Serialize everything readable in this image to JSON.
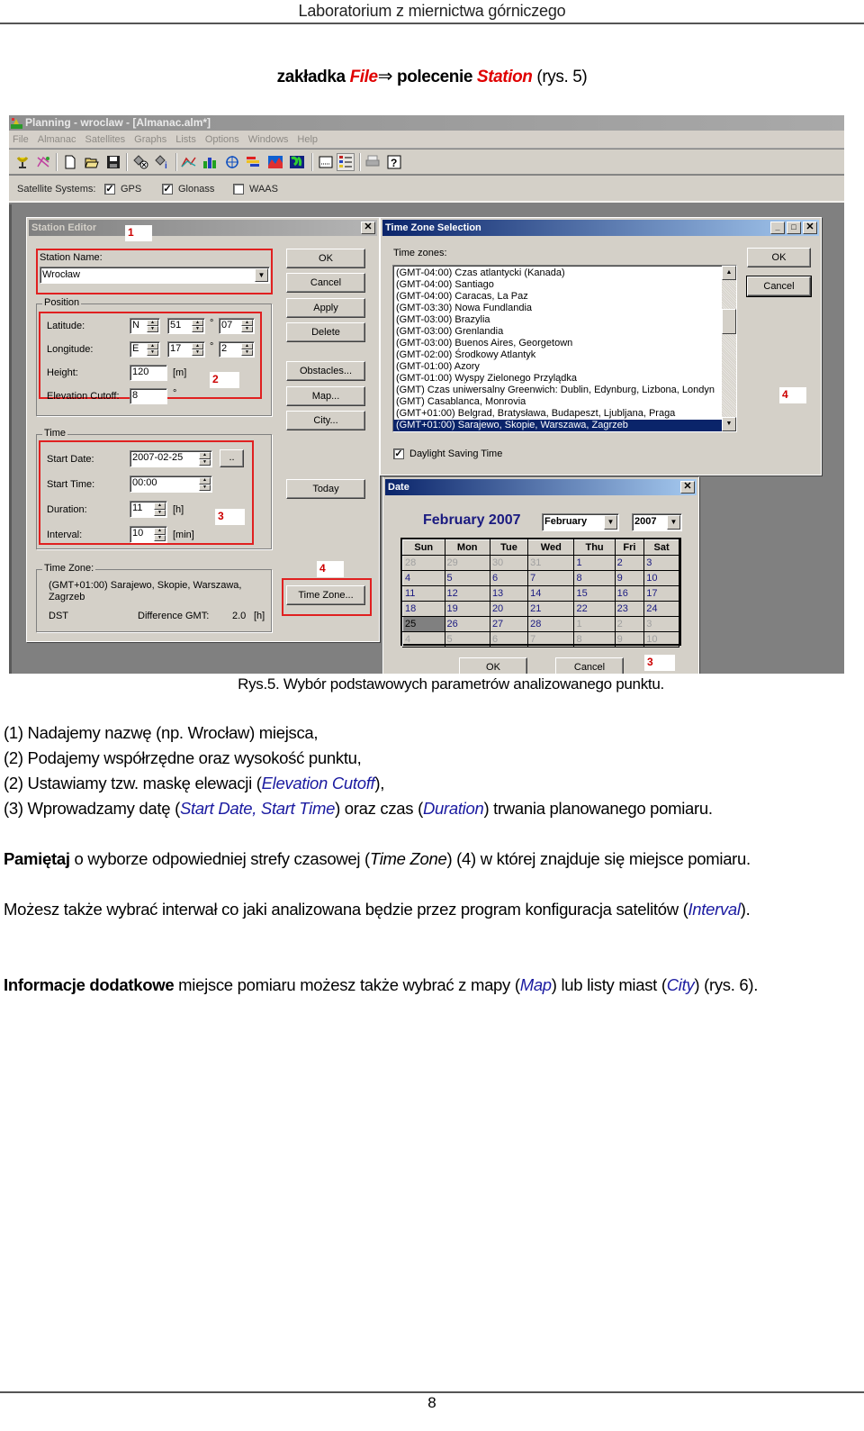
{
  "page_header": "Laboratorium z miernictwa górniczego",
  "heading": {
    "part1": "zakładka",
    "file": "File",
    "arrow": "⇒",
    "part2": "polecenie",
    "station": "Station",
    "part3": "(rys. 5)"
  },
  "app": {
    "title": "Planning - wroclaw - [Almanac.alm*]",
    "menu": [
      "File",
      "Almanac",
      "Satellites",
      "Graphs",
      "Lists",
      "Options",
      "Windows",
      "Help"
    ],
    "toolbar_icons": [
      "station-icon",
      "satellite-path-icon",
      "new-file-icon",
      "open-folder-icon",
      "save-icon",
      "satellite-delete-icon",
      "satellite-info-icon",
      "elevation-graph-icon",
      "number-of-satellites-icon",
      "sky-plot-icon",
      "visibility-icon",
      "dop-graph-icon",
      "world-view-icon",
      "window-icon",
      "list-icon",
      "print-icon",
      "help-icon"
    ],
    "satellite_systems": {
      "label": "Satellite Systems:",
      "items": [
        {
          "label": "GPS",
          "checked": true
        },
        {
          "label": "Glonass",
          "checked": true
        },
        {
          "label": "WAAS",
          "checked": false
        }
      ]
    }
  },
  "station_editor": {
    "title": "Station Editor",
    "station_name_label": "Station Name:",
    "station_name_value": "Wrocław",
    "position_group": "Position",
    "latitude_label": "Latitude:",
    "latitude_hemisphere": "N",
    "latitude_degrees": "51",
    "latitude_minutes": "07",
    "longitude_label": "Longitude:",
    "longitude_hemisphere": "E",
    "longitude_degrees": "17",
    "longitude_minutes": "2",
    "degree_symbol": "°",
    "height_label": "Height:",
    "height_value": "120",
    "height_unit": "[m]",
    "elevation_label": "Elevation Cutoff:",
    "elevation_value": "8",
    "elevation_unit": "°",
    "time_group": "Time",
    "start_date_label": "Start Date:",
    "start_date_value": "2007-02-25",
    "date_picker_button": "..",
    "start_time_label": "Start Time:",
    "start_time_value": "00:00",
    "duration_label": "Duration:",
    "duration_value": "11",
    "duration_unit": "[h]",
    "interval_label": "Interval:",
    "interval_value": "10",
    "interval_unit": "[min]",
    "timezone_group": "Time Zone:",
    "timezone_value": "(GMT+01:00) Sarajewo, Skopie, Warszawa, Zagrzeb",
    "dst_label": "DST",
    "diff_label": "Difference GMT:",
    "diff_value": "2.0",
    "diff_unit": "[h]",
    "buttons": {
      "ok": "OK",
      "cancel": "Cancel",
      "apply": "Apply",
      "delete": "Delete",
      "obstacles": "Obstacles...",
      "map": "Map...",
      "city": "City...",
      "today": "Today",
      "time_zone": "Time Zone..."
    }
  },
  "time_zone_dialog": {
    "title": "Time Zone Selection",
    "list_label": "Time zones:",
    "items": [
      "(GMT-04:00) Czas atlantycki (Kanada)",
      "(GMT-04:00) Santiago",
      "(GMT-04:00) Caracas, La Paz",
      "(GMT-03:30) Nowa Fundlandia",
      "(GMT-03:00) Brazylia",
      "(GMT-03:00) Grenlandia",
      "(GMT-03:00) Buenos Aires, Georgetown",
      "(GMT-02:00) Środkowy Atlantyk",
      "(GMT-01:00) Azory",
      "(GMT-01:00) Wyspy Zielonego Przylądka",
      "(GMT) Czas uniwersalny Greenwich: Dublin, Edynburg, Lizbona, Londyn",
      "(GMT) Casablanca, Monrovia",
      "(GMT+01:00) Belgrad, Bratysława, Budapeszt, Ljubljana, Praga",
      "(GMT+01:00) Sarajewo, Skopie, Warszawa, Zagrzeb"
    ],
    "selected_index": 13,
    "dst_label": "Daylight Saving Time",
    "dst_checked": true,
    "ok": "OK",
    "cancel": "Cancel"
  },
  "date_dialog": {
    "title": "Date",
    "month_year_title": "February 2007",
    "month_select": "February",
    "year_select": "2007",
    "weekdays": [
      "Sun",
      "Mon",
      "Tue",
      "Wed",
      "Thu",
      "Fri",
      "Sat"
    ],
    "weeks": [
      [
        "28",
        "29",
        "30",
        "31",
        "1",
        "2",
        "3"
      ],
      [
        "4",
        "5",
        "6",
        "7",
        "8",
        "9",
        "10"
      ],
      [
        "11",
        "12",
        "13",
        "14",
        "15",
        "16",
        "17"
      ],
      [
        "18",
        "19",
        "20",
        "21",
        "22",
        "23",
        "24"
      ],
      [
        "25",
        "26",
        "27",
        "28",
        "1",
        "2",
        "3"
      ],
      [
        "4",
        "5",
        "6",
        "7",
        "8",
        "9",
        "10"
      ]
    ],
    "selected_day": "25",
    "ok": "OK",
    "cancel": "Cancel"
  },
  "annotations": {
    "n1": "1",
    "n2": "2",
    "n3": "3",
    "n4": "4"
  },
  "caption": "Rys.5. Wybór podstawowych parametrów analizowanego punktu.",
  "steps": {
    "s1": "(1) Nadajemy nazwę (np. Wrocław) miejsca,",
    "s2": "(2) Podajemy współrzędne oraz wysokość punktu,",
    "s3a": "(2) Ustawiamy tzw. maskę elewacji (",
    "s3b": "Elevation Cutoff",
    "s3c": "),",
    "s4a": "(3) Wprowadzamy datę (",
    "s4b": "Start Date, Start Time",
    "s4c": ") oraz czas (",
    "s4d": "Duration",
    "s4e": ") trwania planowanego pomiaru."
  },
  "remember": {
    "bold": "Pamiętaj",
    "a": " o wyborze odpowiedniej strefy czasowej (",
    "b": "Time Zone",
    "c": ") (4) w której znajduje się miejsce pomiaru."
  },
  "interval_note": {
    "a": "Możesz także wybrać interwał co jaki analizowana będzie przez program konfiguracja satelitów (",
    "b": "Interval",
    "c": ")."
  },
  "extra_info": {
    "bold": "Informacje dodatkowe",
    "a": " miejsce pomiaru możesz także wybrać z mapy (",
    "b": "Map",
    "c": ") lub listy miast (",
    "d": "City",
    "e": ") (rys. 6)."
  },
  "page_number": "8"
}
